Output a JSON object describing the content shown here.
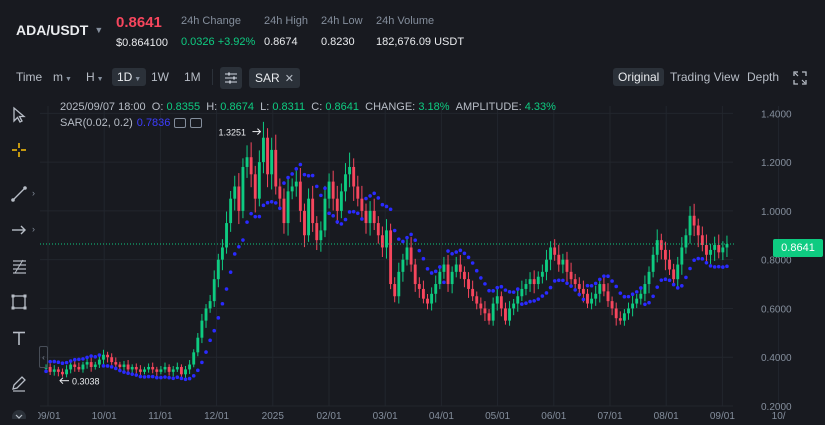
{
  "header": {
    "pair": "ADA/USDT",
    "last_price": "0.8641",
    "last_price_usd": "$0.864100",
    "stats": [
      {
        "label": "24h Change",
        "value": "0.0326 +3.92%",
        "up": true
      },
      {
        "label": "24h High",
        "value": "0.8674"
      },
      {
        "label": "24h Low",
        "value": "0.8230"
      },
      {
        "label": "24h Volume",
        "value": "182,676.09 USDT"
      }
    ]
  },
  "toolbar": {
    "time_label": "Time",
    "m_label": "m",
    "h_label": "H",
    "d_label": "1D",
    "w_label": "1W",
    "mo_label": "1M",
    "sar_label": "SAR",
    "views": [
      "Original",
      "Trading View",
      "Depth"
    ]
  },
  "legend": {
    "date": "2025/09/07 18:00",
    "o_label": "O:",
    "o": "0.8355",
    "h_label": "H:",
    "h": "0.8674",
    "l_label": "L:",
    "l": "0.8311",
    "c_label": "C:",
    "c": "0.8641",
    "change_label": "CHANGE:",
    "change": "3.18%",
    "amp_label": "AMPLITUDE:",
    "amp": "4.33%",
    "sar_label": "SAR(0.02, 0.2)",
    "sar_value": "0.7836"
  },
  "icons": [
    "cursor-icon",
    "crosshair-icon",
    "trend-line-icon",
    "arrow-icon",
    "fib-icon",
    "rectangle-icon",
    "text-icon",
    "pencil-icon",
    "indicator-settings-icon",
    "fullscreen-icon"
  ],
  "colors": {
    "up": "#0ecb81",
    "down": "#f6465d",
    "sar": "#2a2aff",
    "bg": "#181a20"
  },
  "price_tag": "0.8641",
  "chart_data": {
    "type": "candlestick",
    "x_ticks": [
      "09/01",
      "10/01",
      "11/01",
      "12/01",
      "2025",
      "02/01",
      "03/01",
      "04/01",
      "05/01",
      "06/01",
      "07/01",
      "08/01",
      "09/01",
      "10/"
    ],
    "y_ticks": [
      "1.4000",
      "1.2000",
      "1.0000",
      "0.8000",
      "0.6000",
      "0.4000",
      "0.2000"
    ],
    "ylim": [
      0.2,
      1.43
    ],
    "last_price": 0.8641,
    "annotations": [
      {
        "label": "1.3251",
        "value": 1.3251
      },
      {
        "label": "0.3038",
        "value": 0.3038
      }
    ],
    "series_close": [
      0.36,
      0.34,
      0.35,
      0.34,
      0.33,
      0.35,
      0.37,
      0.36,
      0.35,
      0.37,
      0.38,
      0.36,
      0.37,
      0.39,
      0.41,
      0.4,
      0.38,
      0.37,
      0.36,
      0.37,
      0.35,
      0.36,
      0.35,
      0.34,
      0.35,
      0.36,
      0.35,
      0.34,
      0.35,
      0.36,
      0.34,
      0.35,
      0.36,
      0.33,
      0.35,
      0.37,
      0.42,
      0.48,
      0.55,
      0.6,
      0.63,
      0.72,
      0.8,
      0.85,
      0.95,
      1.05,
      1.1,
      1.0,
      1.18,
      1.22,
      1.15,
      1.05,
      1.2,
      1.3,
      1.15,
      1.25,
      1.1,
      1.05,
      0.95,
      1.08,
      1.1,
      1.12,
      1.0,
      0.9,
      1.05,
      0.95,
      0.88,
      0.92,
      1.05,
      1.12,
      1.05,
      1.0,
      1.08,
      1.15,
      1.18,
      1.1,
      1.05,
      1.0,
      0.95,
      1.0,
      0.95,
      0.9,
      0.85,
      0.92,
      0.7,
      0.65,
      0.75,
      0.8,
      0.85,
      0.78,
      0.7,
      0.68,
      0.64,
      0.62,
      0.66,
      0.7,
      0.75,
      0.78,
      0.7,
      0.75,
      0.78,
      0.75,
      0.72,
      0.68,
      0.65,
      0.62,
      0.6,
      0.58,
      0.55,
      0.62,
      0.65,
      0.6,
      0.55,
      0.6,
      0.62,
      0.65,
      0.68,
      0.7,
      0.72,
      0.7,
      0.73,
      0.75,
      0.8,
      0.85,
      0.82,
      0.78,
      0.8,
      0.75,
      0.72,
      0.7,
      0.68,
      0.66,
      0.62,
      0.64,
      0.66,
      0.7,
      0.67,
      0.63,
      0.6,
      0.56,
      0.55,
      0.58,
      0.6,
      0.62,
      0.64,
      0.66,
      0.7,
      0.75,
      0.82,
      0.88,
      0.84,
      0.8,
      0.76,
      0.72,
      0.78,
      0.85,
      0.9,
      0.98,
      0.94,
      0.9,
      0.86,
      0.82,
      0.84,
      0.86,
      0.83,
      0.85,
      0.864
    ]
  }
}
